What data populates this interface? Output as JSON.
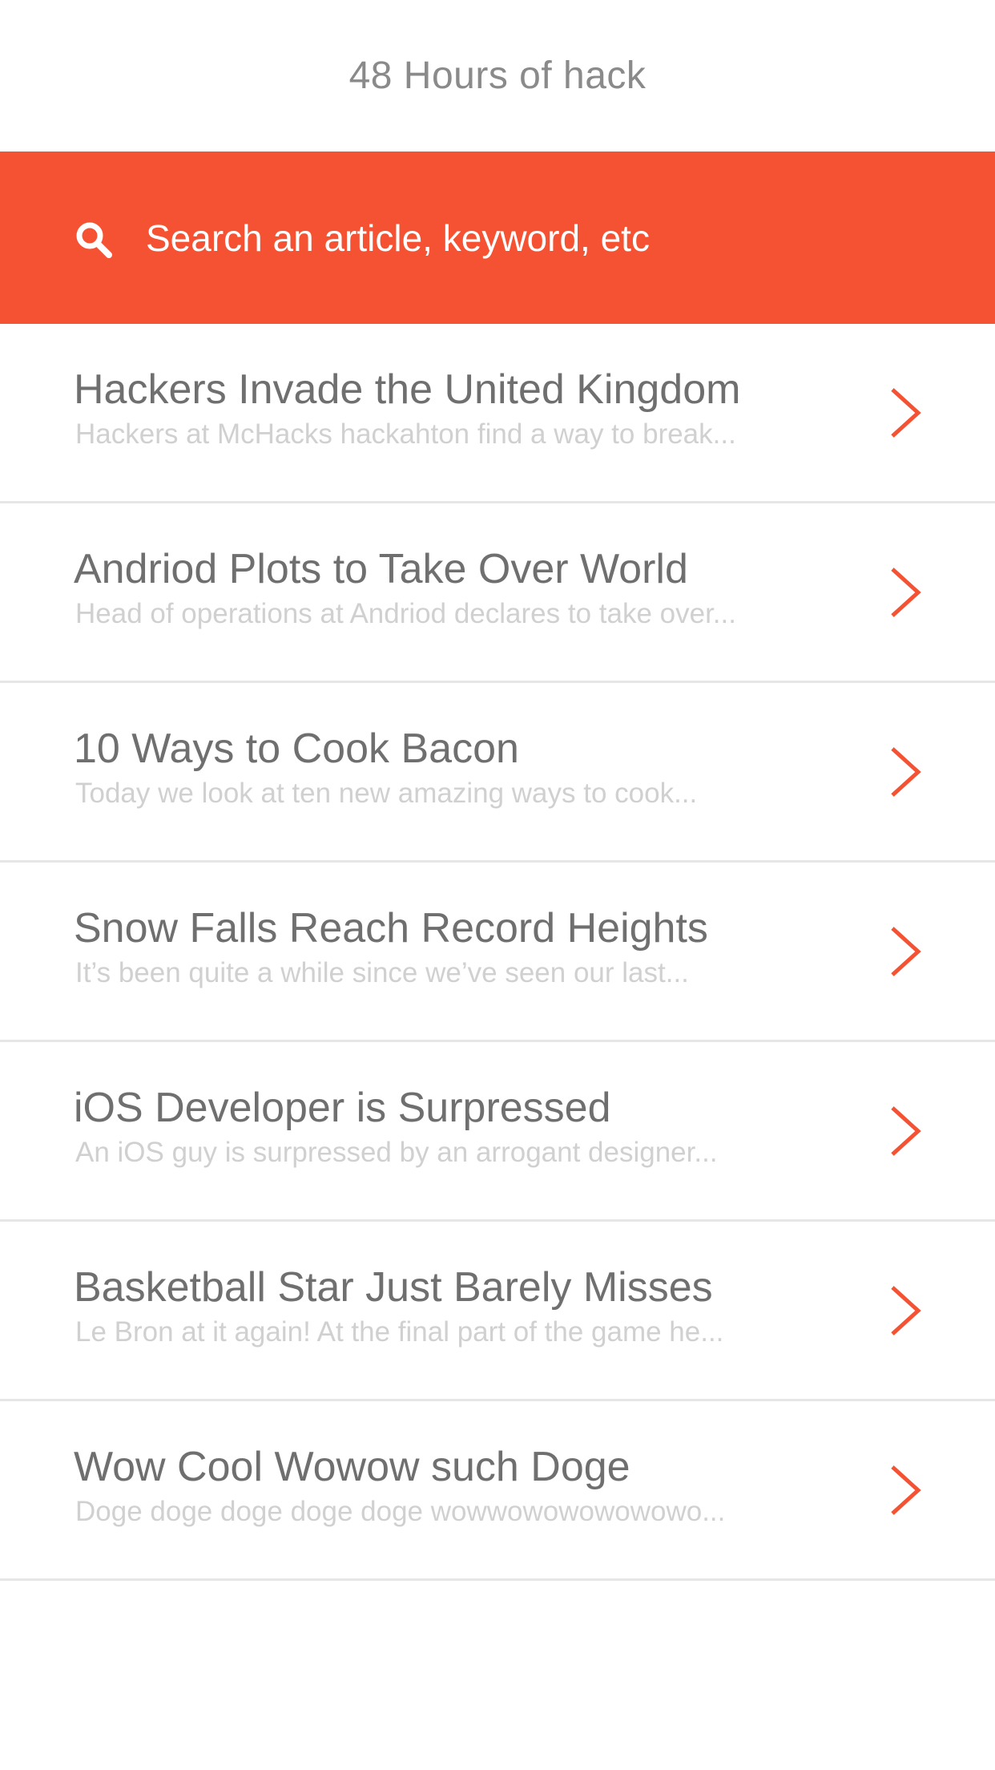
{
  "header": {
    "title": "48 Hours of hack"
  },
  "search": {
    "placeholder": "Search an article, keyword, etc",
    "icon": "search-icon"
  },
  "colors": {
    "accent": "#f55233",
    "title_text": "#6f6f6f",
    "subtitle_text": "#d0d0d0",
    "divider": "#e6e6e6"
  },
  "articles": [
    {
      "title": "Hackers Invade the United Kingdom",
      "subtitle": "Hackers at McHacks hackahton find a way to break...",
      "icon": "chevron-right-icon"
    },
    {
      "title": "Andriod Plots to Take Over World",
      "subtitle": "Head of operations at Andriod declares to take over...",
      "icon": "chevron-right-icon"
    },
    {
      "title": "10 Ways to Cook Bacon",
      "subtitle": "Today we look at ten new amazing ways to cook...",
      "icon": "chevron-right-icon"
    },
    {
      "title": "Snow Falls Reach Record Heights",
      "subtitle": "It’s been quite a while since we’ve seen our last...",
      "icon": "chevron-right-icon"
    },
    {
      "title": "iOS Developer is Surpressed",
      "subtitle": "An iOS guy is surpressed by an arrogant designer...",
      "icon": "chevron-right-icon"
    },
    {
      "title": "Basketball Star Just Barely Misses",
      "subtitle": "Le Bron at it again! At the final part of the game he...",
      "icon": "chevron-right-icon"
    },
    {
      "title": "Wow Cool Wowow such Doge",
      "subtitle": "Doge doge doge doge doge wowwowowowowowo...",
      "icon": "chevron-right-icon"
    }
  ]
}
